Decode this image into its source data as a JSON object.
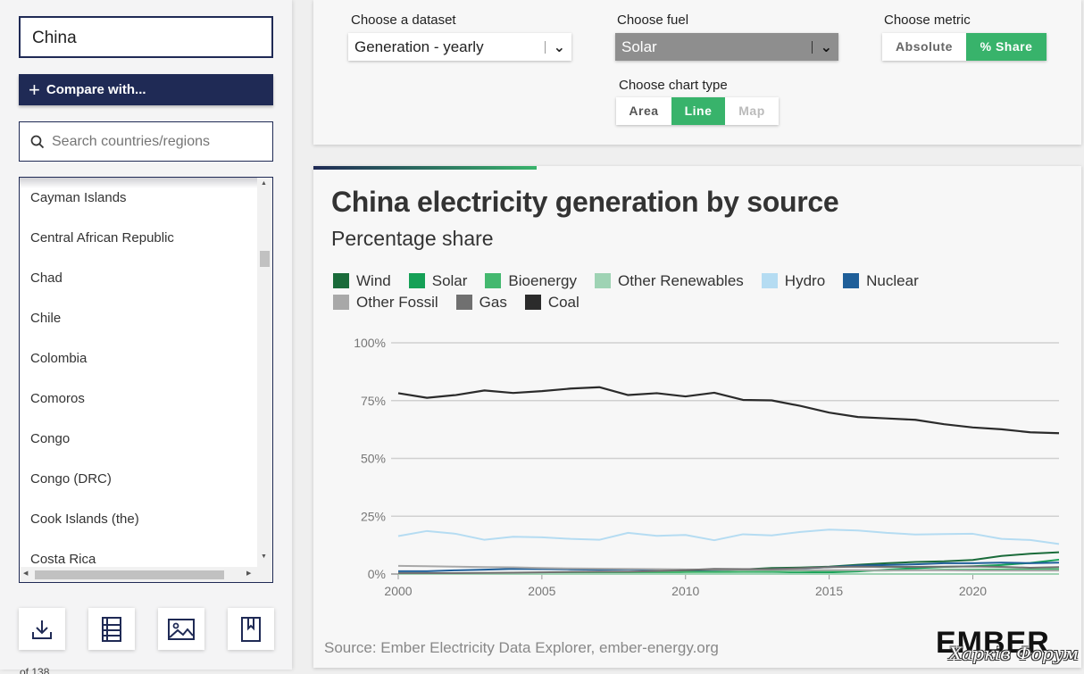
{
  "sidebar": {
    "selected_country": "China",
    "compare_label": "Compare with...",
    "search_placeholder": "Search countries/regions",
    "countries": [
      "Cayman Islands",
      "Central African Republic",
      "Chad",
      "Chile",
      "Colombia",
      "Comoros",
      "Congo",
      "Congo (DRC)",
      "Cook Islands (the)",
      "Costa Rica"
    ],
    "footer_text": "of 138"
  },
  "controls": {
    "dataset_label": "Choose a dataset",
    "dataset_value": "Generation - yearly",
    "fuel_label": "Choose fuel",
    "fuel_value": "Solar",
    "metric_label": "Choose metric",
    "metric_options": [
      "Absolute",
      "% Share"
    ],
    "metric_selected": "% Share",
    "chart_type_label": "Choose chart type",
    "chart_type_options": [
      "Area",
      "Line",
      "Map"
    ],
    "chart_type_selected": "Line"
  },
  "chart_card": {
    "source": "Source: Ember Electricity Data Explorer, ember-energy.org",
    "logo": "EMBER",
    "watermark": "Харків Форум"
  },
  "chart_data": {
    "type": "line",
    "title": "China electricity generation by source",
    "subtitle": "Percentage share",
    "x": [
      2000,
      2001,
      2002,
      2003,
      2004,
      2005,
      2006,
      2007,
      2008,
      2009,
      2010,
      2011,
      2012,
      2013,
      2014,
      2015,
      2016,
      2017,
      2018,
      2019,
      2020,
      2021,
      2022,
      2023
    ],
    "xticks": [
      2000,
      2005,
      2010,
      2015,
      2020
    ],
    "yticks": [
      "0%",
      "25%",
      "50%",
      "75%",
      "100%"
    ],
    "ylim": [
      0,
      100
    ],
    "grid": true,
    "legend_position": "top",
    "series": [
      {
        "name": "Wind",
        "color": "#1a6b3a",
        "values": [
          0.0,
          0.0,
          0.0,
          0.0,
          0.1,
          0.1,
          0.1,
          0.2,
          0.4,
          0.7,
          1.2,
          1.5,
          2.0,
          2.6,
          2.8,
          3.2,
          4.0,
          4.7,
          5.2,
          5.5,
          6.1,
          7.8,
          8.8,
          9.4
        ]
      },
      {
        "name": "Solar",
        "color": "#15a056",
        "values": [
          0,
          0,
          0,
          0,
          0,
          0,
          0,
          0,
          0,
          0,
          0,
          0.1,
          0.1,
          0.2,
          0.5,
          0.7,
          1.1,
          1.9,
          2.5,
          3.1,
          3.4,
          3.9,
          4.8,
          6.2
        ]
      },
      {
        "name": "Bioenergy",
        "color": "#44b86f",
        "values": [
          0.2,
          0.2,
          0.2,
          0.2,
          0.2,
          0.3,
          0.4,
          0.5,
          0.6,
          0.7,
          0.8,
          0.9,
          1.0,
          1.1,
          1.3,
          1.4,
          1.5,
          1.5,
          1.7,
          1.9,
          1.9,
          2.0,
          2.0,
          2.1
        ]
      },
      {
        "name": "Other Renewables",
        "color": "#9fd3b4",
        "values": [
          0,
          0,
          0,
          0,
          0,
          0,
          0,
          0,
          0,
          0,
          0,
          0,
          0,
          0,
          0,
          0,
          0,
          0,
          0,
          0,
          0,
          0,
          0,
          0
        ]
      },
      {
        "name": "Hydro",
        "color": "#b5dcf2",
        "values": [
          16.4,
          18.6,
          17.4,
          14.8,
          16.1,
          15.9,
          15.2,
          14.8,
          17.8,
          16.5,
          16.9,
          14.6,
          17.2,
          16.7,
          18.2,
          19.2,
          18.8,
          17.8,
          17.1,
          17.3,
          17.4,
          15.2,
          14.7,
          13.0
        ]
      },
      {
        "name": "Nuclear",
        "color": "#1f5f99",
        "values": [
          1.2,
          1.2,
          1.6,
          1.9,
          2.2,
          2.1,
          2.0,
          1.9,
          2.0,
          1.9,
          1.8,
          1.8,
          2.0,
          2.1,
          2.4,
          3.0,
          3.6,
          3.9,
          4.2,
          4.7,
          4.7,
          4.9,
          4.7,
          4.9
        ]
      },
      {
        "name": "Other Fossil",
        "color": "#a8a8a8",
        "values": [
          3.5,
          3.4,
          3.2,
          3.0,
          2.9,
          2.6,
          2.4,
          2.3,
          2.2,
          2.1,
          2.0,
          1.9,
          1.8,
          1.8,
          1.7,
          1.7,
          1.7,
          1.6,
          1.6,
          1.6,
          1.5,
          1.5,
          1.5,
          1.5
        ]
      },
      {
        "name": "Gas",
        "color": "#707070",
        "values": [
          0.4,
          0.4,
          0.4,
          0.5,
          0.6,
          0.7,
          0.9,
          1.0,
          1.0,
          1.3,
          1.7,
          2.2,
          2.1,
          2.1,
          2.5,
          3.0,
          3.2,
          3.1,
          3.1,
          3.2,
          3.3,
          3.1,
          2.7,
          3.0
        ]
      },
      {
        "name": "Coal",
        "color": "#2b2b2b",
        "values": [
          78.2,
          76.2,
          77.4,
          79.4,
          78.3,
          79.1,
          80.2,
          80.8,
          77.4,
          78.2,
          76.8,
          78.4,
          75.3,
          75.1,
          72.7,
          69.8,
          67.9,
          67.3,
          66.7,
          64.8,
          63.4,
          62.6,
          61.3,
          60.9
        ]
      }
    ]
  }
}
